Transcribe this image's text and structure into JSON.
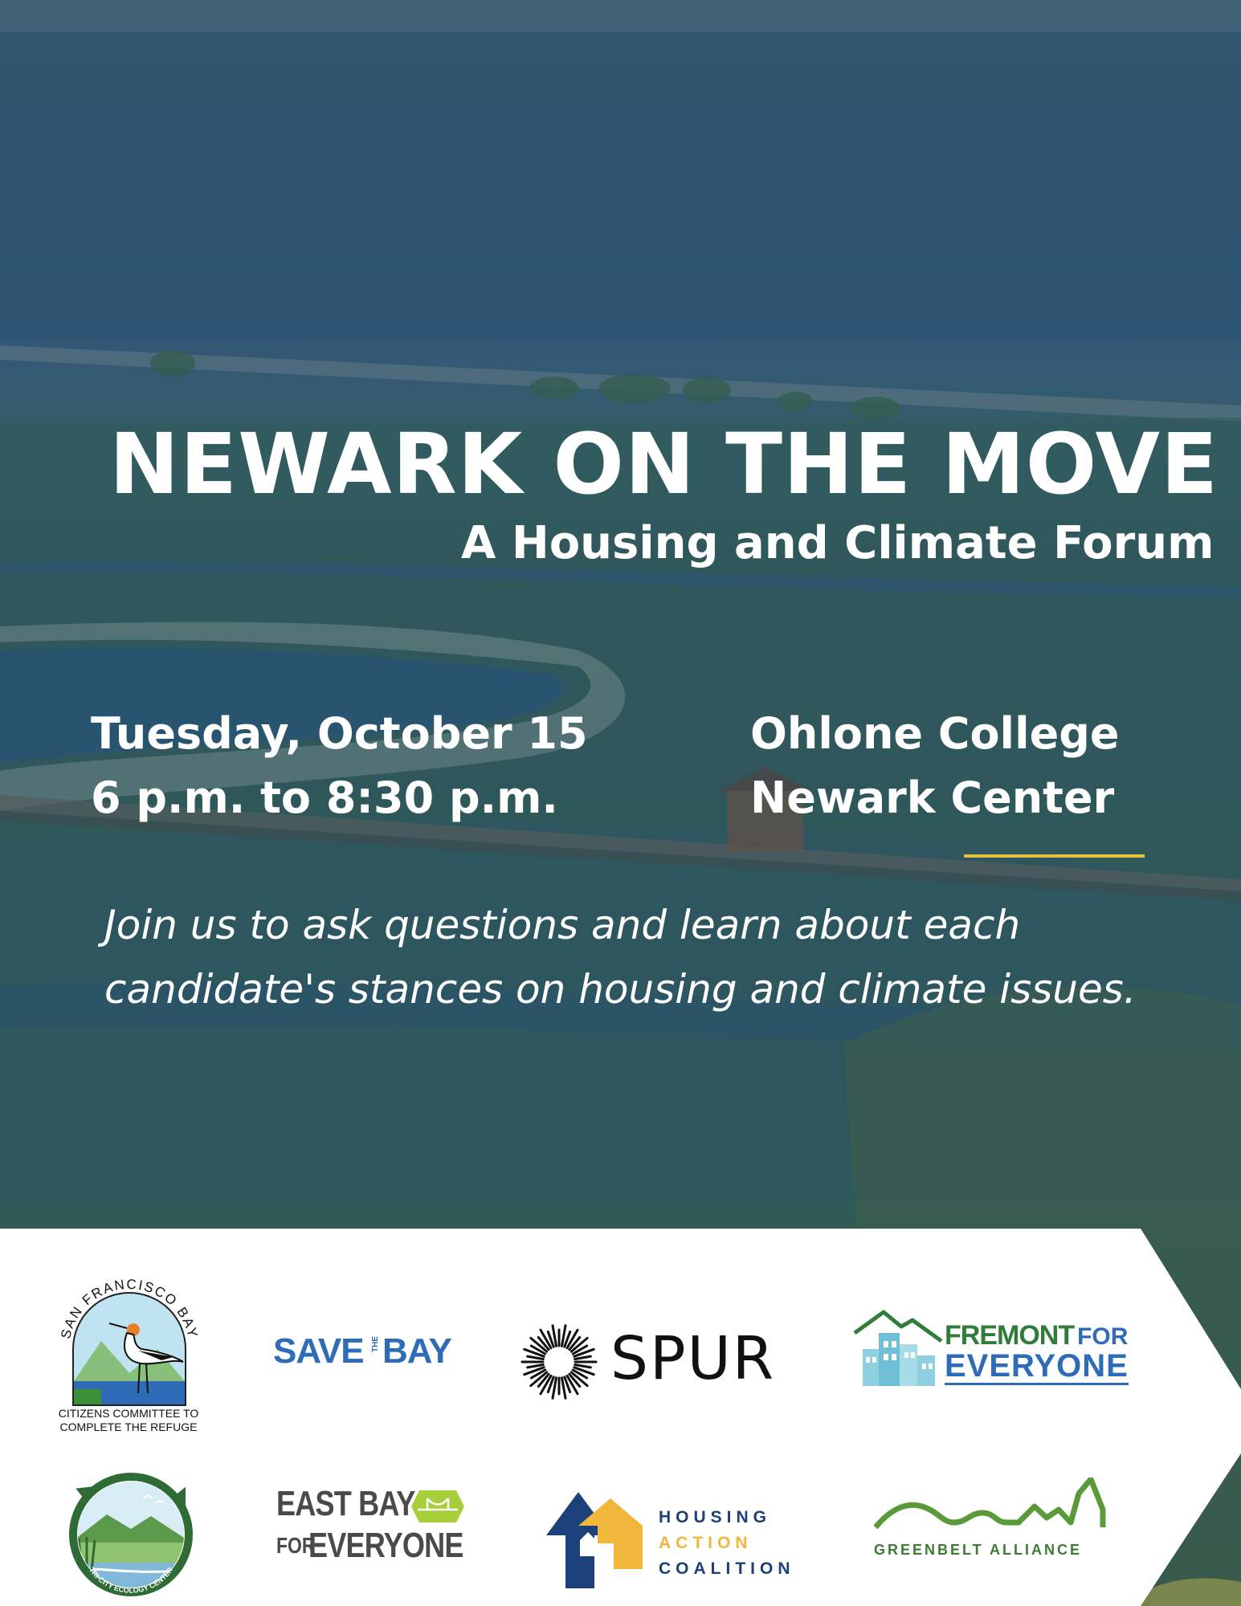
{
  "event": {
    "title": "NEWARK ON THE MOVE",
    "subtitle": "A Housing and Climate Forum",
    "date": "Tuesday, October 15",
    "time": "6 p.m. to 8:30 p.m.",
    "venue_line1": "Ohlone College",
    "venue_line2": "Newark Center",
    "blurb_line1": "Join us to ask questions and learn about each",
    "blurb_line2": "candidate's stances on housing and climate issues.",
    "accent_color": "#e6c23a"
  },
  "sponsors": {
    "sfbay": {
      "arc_text": "SAN FRANCISCO BAY",
      "caption_line1": "CITIZENS COMMITTEE TO",
      "caption_line2": "COMPLETE THE REFUGE"
    },
    "savebay": {
      "save": "SAVE",
      "the": "THE",
      "bay": "BAY",
      "color": "#2f6cb7"
    },
    "spur": {
      "name": "SPUR"
    },
    "fremont": {
      "fremont": "FREMONT",
      "for": "FOR",
      "everyone": "EVERYONE"
    },
    "tricity": {
      "ring_text": "TRI-CITY ECOLOGY CENTER"
    },
    "eastbay": {
      "line1": "EAST BAY",
      "for": "FOR",
      "everyone": "EVERYONE"
    },
    "hac": {
      "housing": "HOUSING",
      "action": "ACTION",
      "coalition": "COALITION"
    },
    "greenbelt": {
      "name": "GREENBELT ALLIANCE"
    }
  }
}
